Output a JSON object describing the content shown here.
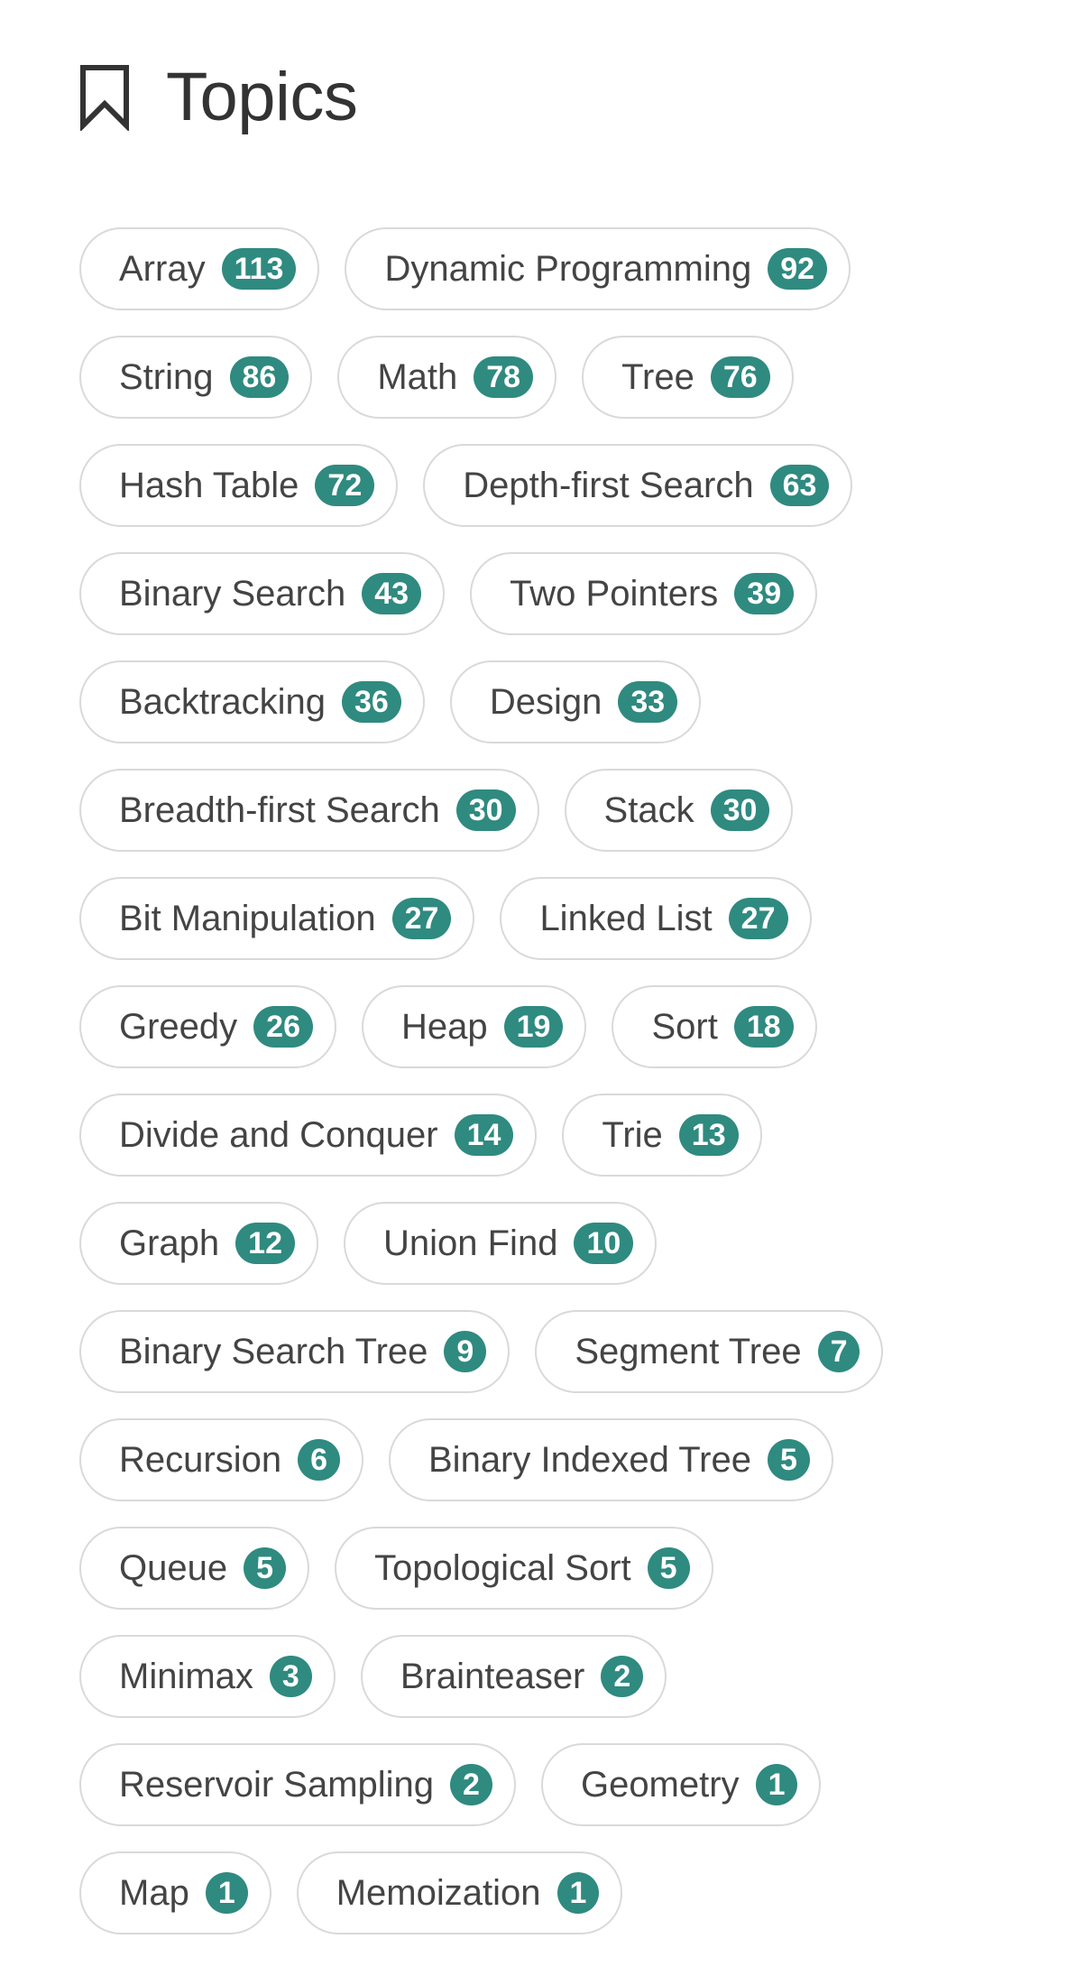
{
  "header": {
    "title": "Topics",
    "icon": "bookmark-icon"
  },
  "colors": {
    "badge": "#2f8a80",
    "border": "#d9d9d9",
    "text": "#444444"
  },
  "rows": [
    [
      {
        "label": "Array",
        "count": "113"
      },
      {
        "label": "Dynamic Programming",
        "count": "92"
      }
    ],
    [
      {
        "label": "String",
        "count": "86"
      },
      {
        "label": "Math",
        "count": "78"
      },
      {
        "label": "Tree",
        "count": "76"
      }
    ],
    [
      {
        "label": "Hash Table",
        "count": "72"
      },
      {
        "label": "Depth-first Search",
        "count": "63"
      }
    ],
    [
      {
        "label": "Binary Search",
        "count": "43"
      },
      {
        "label": "Two Pointers",
        "count": "39"
      }
    ],
    [
      {
        "label": "Backtracking",
        "count": "36"
      },
      {
        "label": "Design",
        "count": "33"
      }
    ],
    [
      {
        "label": "Breadth-first Search",
        "count": "30"
      },
      {
        "label": "Stack",
        "count": "30"
      }
    ],
    [
      {
        "label": "Bit Manipulation",
        "count": "27"
      },
      {
        "label": "Linked List",
        "count": "27"
      }
    ],
    [
      {
        "label": "Greedy",
        "count": "26"
      },
      {
        "label": "Heap",
        "count": "19"
      },
      {
        "label": "Sort",
        "count": "18"
      }
    ],
    [
      {
        "label": "Divide and Conquer",
        "count": "14"
      },
      {
        "label": "Trie",
        "count": "13"
      }
    ],
    [
      {
        "label": "Graph",
        "count": "12"
      },
      {
        "label": "Union Find",
        "count": "10"
      }
    ],
    [
      {
        "label": "Binary Search Tree",
        "count": "9"
      },
      {
        "label": "Segment Tree",
        "count": "7"
      }
    ],
    [
      {
        "label": "Recursion",
        "count": "6"
      },
      {
        "label": "Binary Indexed Tree",
        "count": "5"
      }
    ],
    [
      {
        "label": "Queue",
        "count": "5"
      },
      {
        "label": "Topological Sort",
        "count": "5"
      }
    ],
    [
      {
        "label": "Minimax",
        "count": "3"
      },
      {
        "label": "Brainteaser",
        "count": "2"
      }
    ],
    [
      {
        "label": "Reservoir Sampling",
        "count": "2"
      },
      {
        "label": "Geometry",
        "count": "1"
      }
    ],
    [
      {
        "label": "Map",
        "count": "1"
      },
      {
        "label": "Memoization",
        "count": "1"
      }
    ]
  ]
}
